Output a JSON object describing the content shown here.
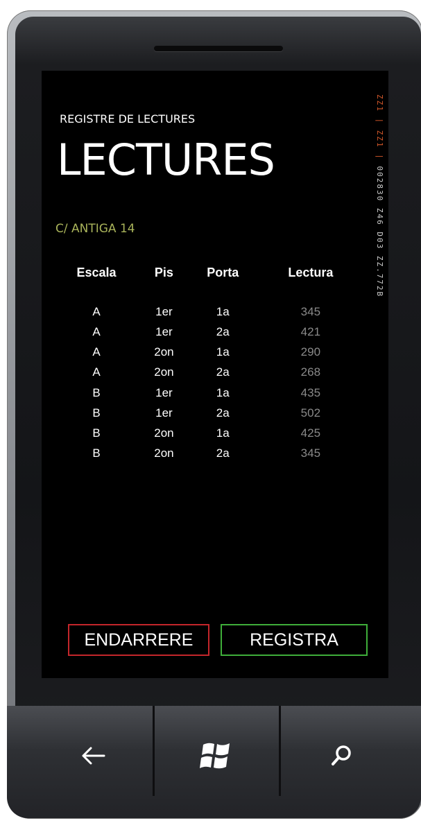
{
  "app": {
    "app_name": "REGISTRE DE LECTURES",
    "page_title": "LECTURES",
    "address": "C/ ANTIGA 14"
  },
  "table": {
    "headers": [
      "Escala",
      "Pis",
      "Porta",
      "Lectura"
    ],
    "rows": [
      [
        "A",
        "1er",
        "1a",
        "345"
      ],
      [
        "A",
        "1er",
        "2a",
        "421"
      ],
      [
        "A",
        "2on",
        "1a",
        "290"
      ],
      [
        "A",
        "2on",
        "2a",
        "268"
      ],
      [
        "B",
        "1er",
        "1a",
        "435"
      ],
      [
        "B",
        "1er",
        "2a",
        "502"
      ],
      [
        "B",
        "2on",
        "1a",
        "425"
      ],
      [
        "B",
        "2on",
        "2a",
        "345"
      ]
    ]
  },
  "side_strip": {
    "accent_text": "ZZ1 | ZZ1 |",
    "text": " 002830 Z46 D03 ZZ.772B"
  },
  "buttons": {
    "back_label": "ENDARRERE",
    "register_label": "REGISTRA"
  },
  "hardware": {
    "back_icon": "arrow-left-icon",
    "start_icon": "windows-logo-icon",
    "search_icon": "search-icon"
  },
  "colors": {
    "address": "#a9b35a",
    "reading_value": "#8a8a8a",
    "back_border": "#c4262b",
    "register_border": "#3fae3a",
    "screen_bg": "#000000",
    "accent_strip": "#d4582a"
  }
}
